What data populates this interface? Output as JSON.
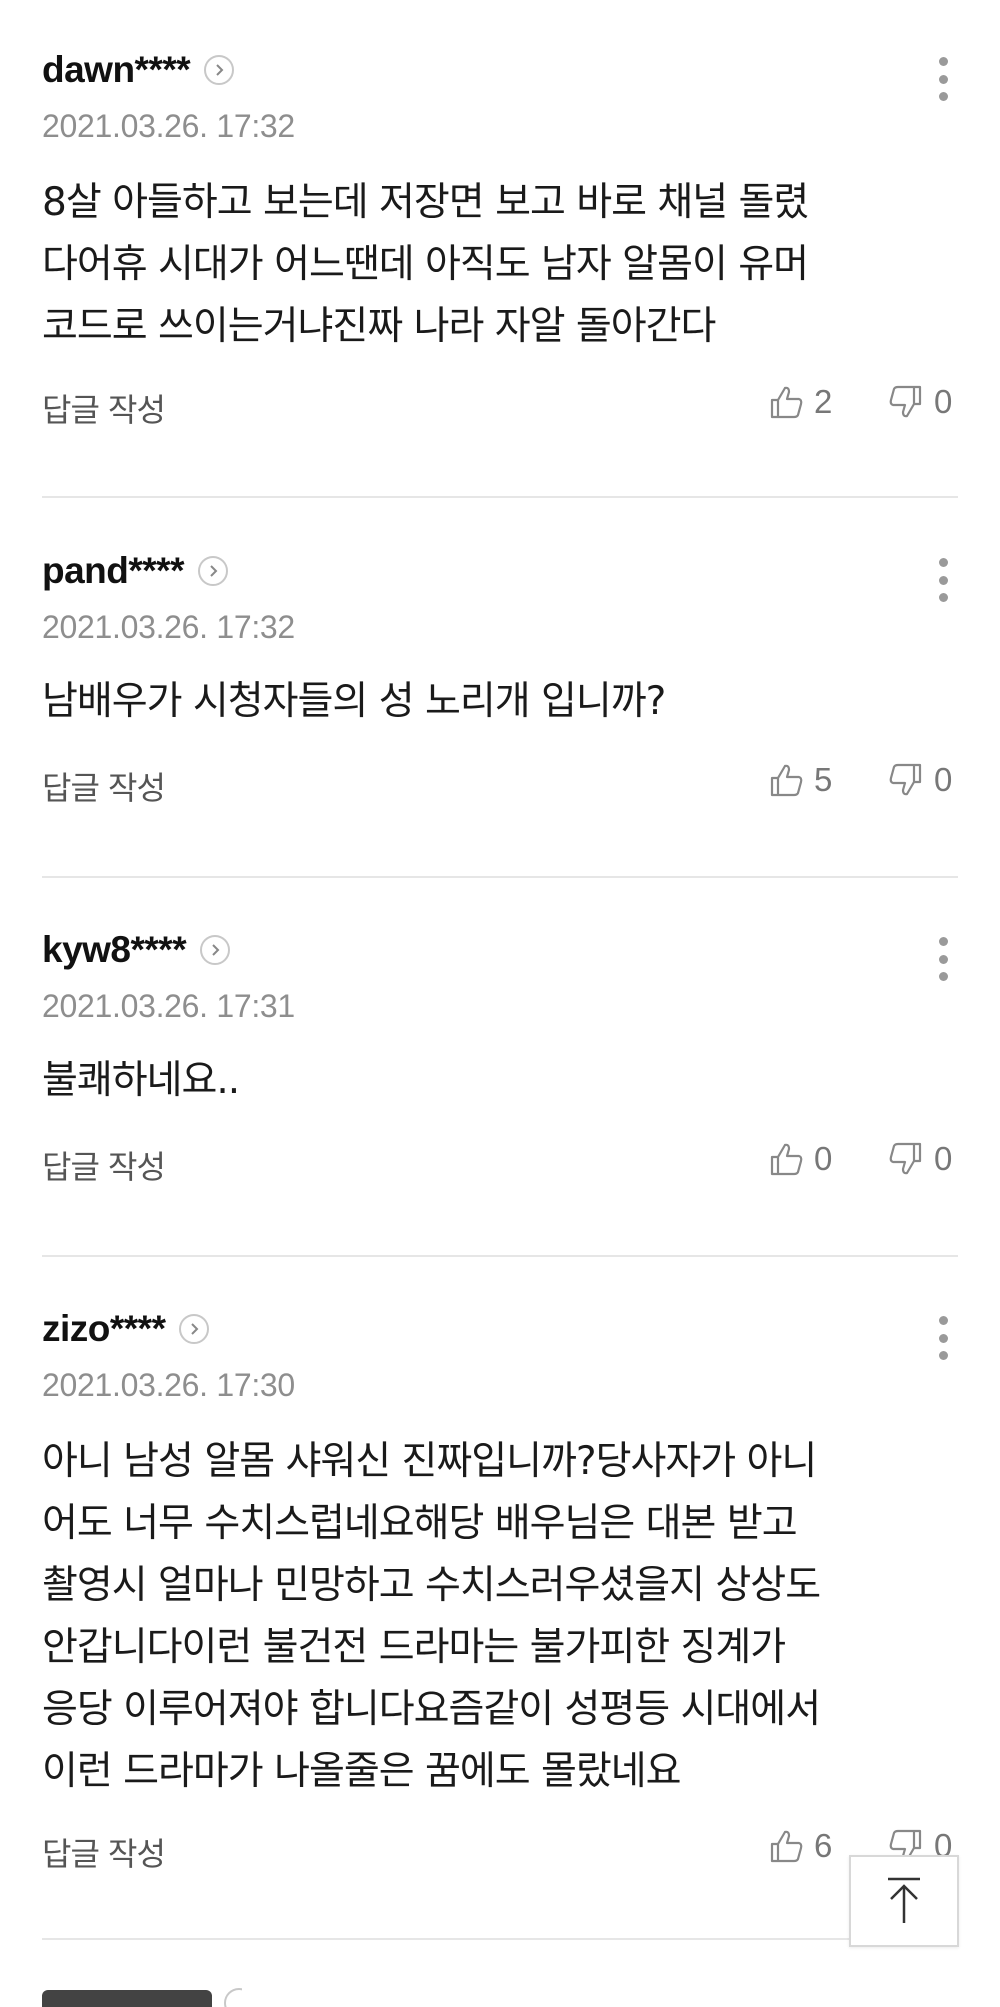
{
  "reply_label": "답글 작성",
  "comments": [
    {
      "username": "dawn****",
      "date": "2021.03.26. 17:32",
      "text": "8살 아들하고 보는데 저장면 보고 바로 채널 돌렸\n다어휴 시대가 어느땐데 아직도 남자 알몸이 유머\n코드로 쓰이는거냐진짜 나라 자알 돌아간다",
      "likes": "2",
      "dislikes": "0"
    },
    {
      "username": "pand****",
      "date": "2021.03.26. 17:32",
      "text": "남배우가 시청자들의 성 노리개 입니까?",
      "likes": "5",
      "dislikes": "0"
    },
    {
      "username": "kyw8****",
      "date": "2021.03.26. 17:31",
      "text": "불쾌하네요..",
      "likes": "0",
      "dislikes": "0"
    },
    {
      "username": "zizo****",
      "date": "2021.03.26. 17:30",
      "text": "아니 남성 알몸 샤워신 진짜입니까?당사자가 아니\n어도 너무 수치스럽네요해당 배우님은 대본 받고\n촬영시 얼마나 민망하고 수치스러우셨을지 상상도\n안갑니다이런 불건전 드라마는 불가피한 징계가\n응당 이루어져야 합니다요즘같이 성평등 시대에서\n이런 드라마가 나올줄은 꿈에도 몰랐네요",
      "likes": "6",
      "dislikes": "0"
    }
  ],
  "icons": {
    "profile": "chevron-right-icon",
    "more": "more-vertical-icon",
    "like": "thumbs-up-icon",
    "dislike": "thumbs-down-icon",
    "top": "arrow-up-icon"
  },
  "colors": {
    "username": "#111111",
    "date": "#8e8e8e",
    "divider": "#e6e6e6",
    "vote": "#777777"
  }
}
